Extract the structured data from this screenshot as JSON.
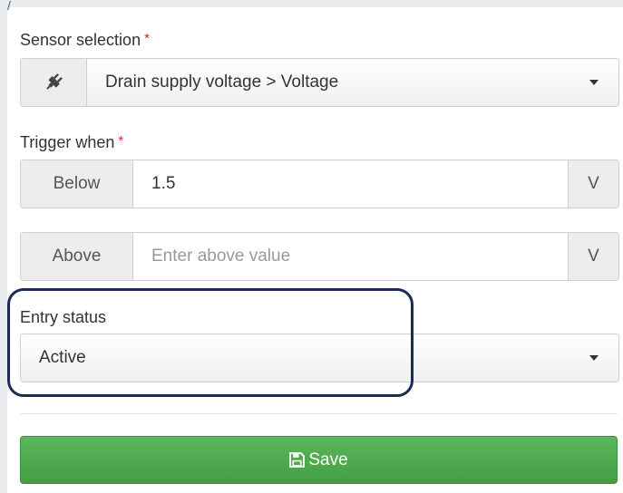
{
  "sensor": {
    "label": "Sensor selection",
    "required_mark": "*",
    "icon": "plug-icon",
    "selected": "Drain supply voltage > Voltage"
  },
  "trigger": {
    "label": "Trigger when",
    "required_mark": "*",
    "below": {
      "label": "Below",
      "value": "1.5",
      "placeholder": "",
      "unit": "V"
    },
    "above": {
      "label": "Above",
      "value": "",
      "placeholder": "Enter above value",
      "unit": "V"
    }
  },
  "entry_status": {
    "label": "Entry status",
    "selected": "Active"
  },
  "save": {
    "label": "Save",
    "icon": "floppy-disk-icon"
  },
  "colors": {
    "accent": "#5cb85c",
    "required": "#e02020",
    "highlight": "#1a2b55"
  }
}
